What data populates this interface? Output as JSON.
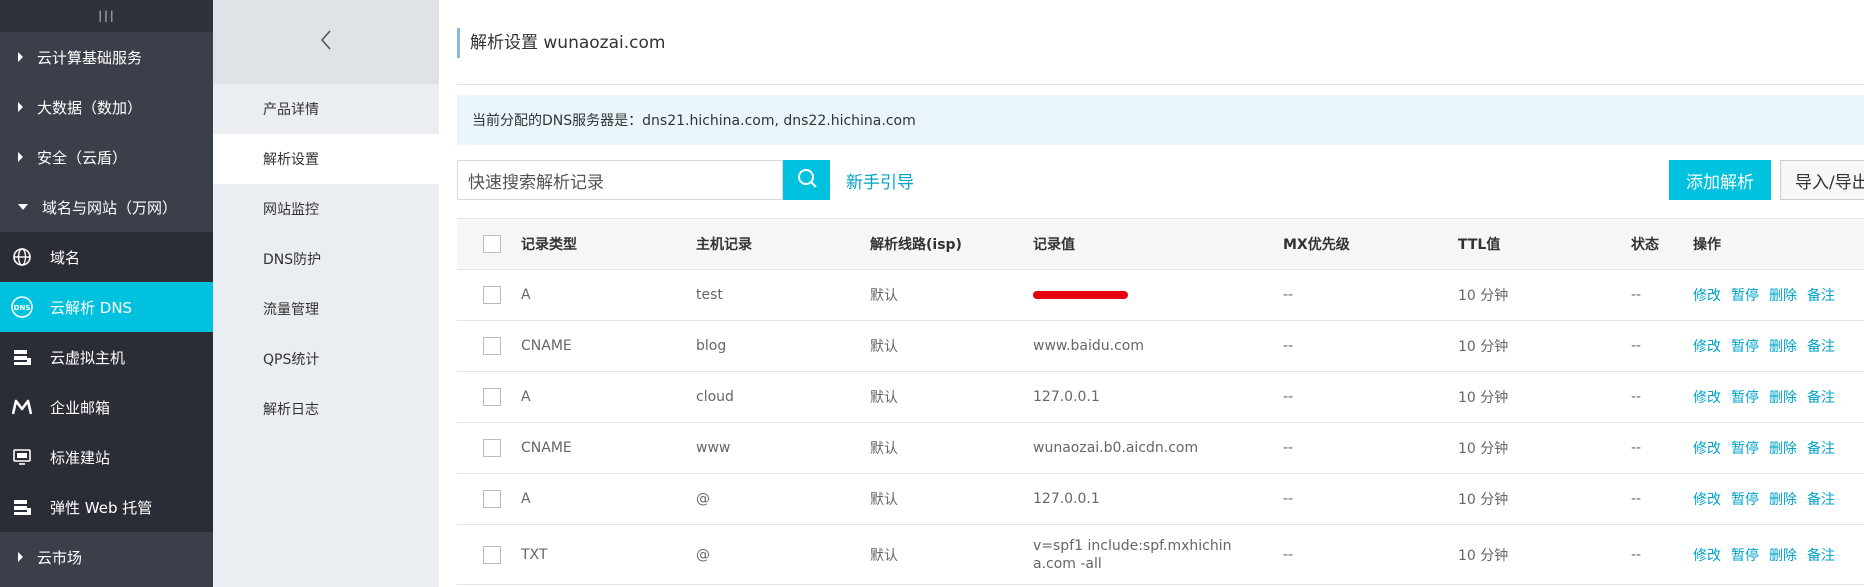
{
  "sidebar": {
    "toggle": "III",
    "groups": [
      {
        "label": "云计算基础服务"
      },
      {
        "label": "大数据（数加）"
      },
      {
        "label": "安全（云盾）"
      },
      {
        "label": "域名与网站（万网）"
      }
    ],
    "items": [
      {
        "label": "域名",
        "icon": "globe-icon"
      },
      {
        "label": "云解析 DNS",
        "icon": "dns-icon"
      },
      {
        "label": "云虚拟主机",
        "icon": "server-icon"
      },
      {
        "label": "企业邮箱",
        "icon": "mail-icon"
      },
      {
        "label": "标准建站",
        "icon": "monitor-icon"
      },
      {
        "label": "弹性 Web 托管",
        "icon": "server-icon"
      }
    ],
    "market": {
      "label": "云市场"
    }
  },
  "subnav": {
    "items": [
      "产品详情",
      "解析设置",
      "网站监控",
      "DNS防护",
      "流量管理",
      "QPS统计",
      "解析日志"
    ]
  },
  "main": {
    "title": "解析设置 wunaozai.com",
    "notice": "当前分配的DNS服务器是：dns21.hichina.com, dns22.hichina.com",
    "search_placeholder": "快速搜索解析记录",
    "guide": "新手引导",
    "add_button": "添加解析",
    "import_button": "导入/导出"
  },
  "table": {
    "headers": [
      "记录类型",
      "主机记录",
      "解析线路(isp)",
      "记录值",
      "MX优先级",
      "TTL值",
      "状态",
      "操作"
    ],
    "actions": [
      "修改",
      "暂停",
      "删除",
      "备注"
    ],
    "rows": [
      {
        "type": "A",
        "host": "test",
        "line": "默认",
        "value": "",
        "mx": "--",
        "ttl": "10 分钟",
        "status": "--"
      },
      {
        "type": "CNAME",
        "host": "blog",
        "line": "默认",
        "value": "www.baidu.com",
        "mx": "--",
        "ttl": "10 分钟",
        "status": "--"
      },
      {
        "type": "A",
        "host": "cloud",
        "line": "默认",
        "value": "127.0.0.1",
        "mx": "--",
        "ttl": "10 分钟",
        "status": "--"
      },
      {
        "type": "CNAME",
        "host": "www",
        "line": "默认",
        "value": "wunaozai.b0.aicdn.com",
        "mx": "--",
        "ttl": "10 分钟",
        "status": "--"
      },
      {
        "type": "A",
        "host": "@",
        "line": "默认",
        "value": "127.0.0.1",
        "mx": "--",
        "ttl": "10 分钟",
        "status": "--"
      },
      {
        "type": "TXT",
        "host": "@",
        "line": "默认",
        "value": "v=spf1 include:spf.mxhichina.com -all",
        "mx": "--",
        "ttl": "10 分钟",
        "status": "--"
      }
    ]
  },
  "colors": {
    "accent": "#00c1de",
    "link": "#00a2ca",
    "sidebar": "#3b3f49"
  }
}
